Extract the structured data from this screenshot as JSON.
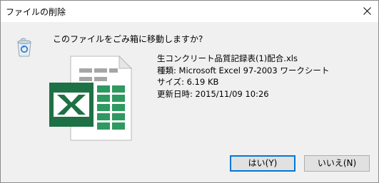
{
  "window": {
    "title": "ファイルの削除"
  },
  "dialog": {
    "question": "このファイルをごみ箱に移動しますか?",
    "file": {
      "name": "生コンクリート品質記録表(1)配合.xls",
      "type": "種類: Microsoft Excel 97-2003 ワークシート",
      "size": "サイズ: 6.19 KB",
      "modified": "更新日時: 2015/11/09 10:26"
    },
    "buttons": {
      "yes_label": "はい(Y)",
      "no_label": "いいえ(N)"
    }
  },
  "icons": {
    "close": "close-icon",
    "recycle_bin": "recycle-bin-icon",
    "excel_file": "excel-file-icon"
  },
  "colors": {
    "excel_green": "#1e7145",
    "focus_border": "#0078d7",
    "dialog_bg": "#f0f0f0"
  }
}
